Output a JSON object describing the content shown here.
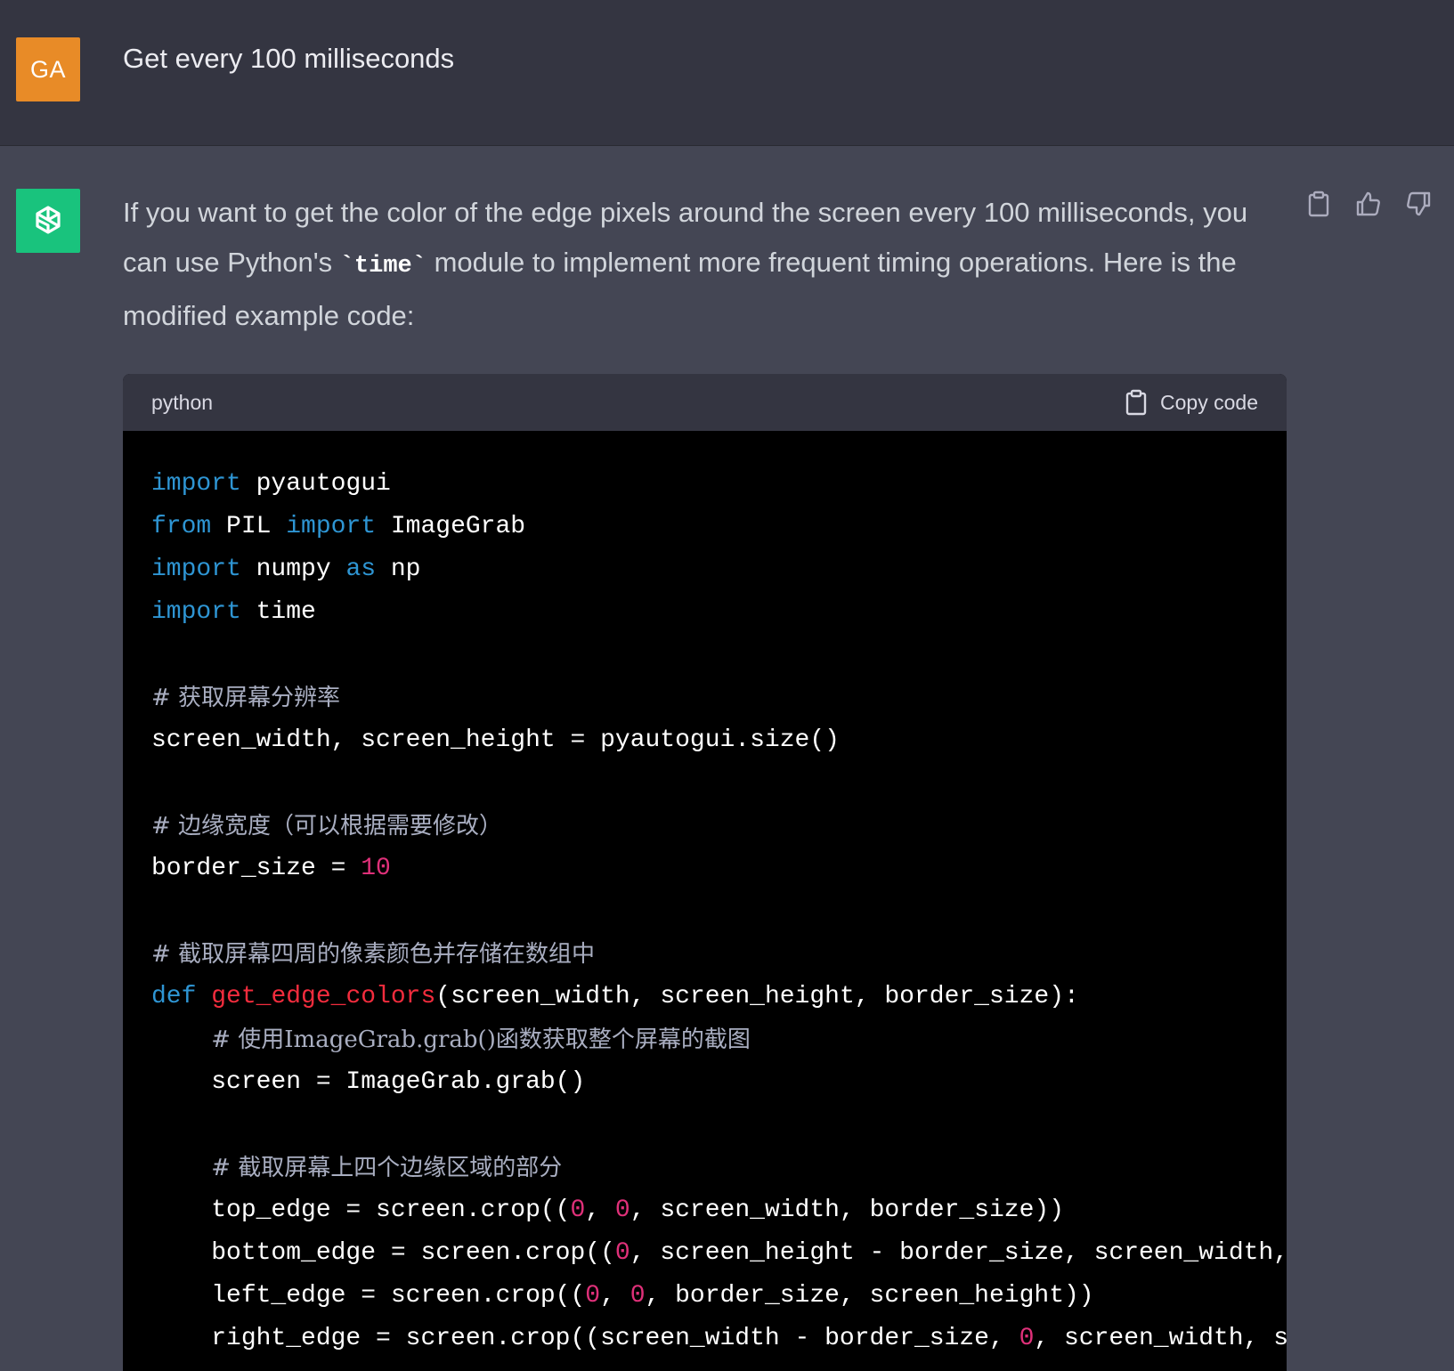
{
  "user": {
    "avatar_initials": "GA",
    "avatar_color": "#e88b27",
    "message": "Get every 100 milliseconds"
  },
  "assistant": {
    "avatar_icon": "openai-logo-icon",
    "avatar_color": "#19c37d",
    "reply_part1": "If you want to get the color of the edge pixels around the screen every 100 milliseconds, you can use Python's ",
    "reply_code": "`time`",
    "reply_part2": " module to implement more frequent timing operations. Here is the modified example code:",
    "actions": [
      "clipboard-icon",
      "thumbs-up-icon",
      "thumbs-down-icon"
    ]
  },
  "code_block": {
    "language": "python",
    "copy_label": "Copy code",
    "lines": [
      [
        [
          "kw",
          "import"
        ],
        [
          "t",
          " pyautogui"
        ]
      ],
      [
        [
          "kw",
          "from"
        ],
        [
          "t",
          " PIL "
        ],
        [
          "kw",
          "import"
        ],
        [
          "t",
          " ImageGrab"
        ]
      ],
      [
        [
          "kw",
          "import"
        ],
        [
          "t",
          " numpy "
        ],
        [
          "kw",
          "as"
        ],
        [
          "t",
          " np"
        ]
      ],
      [
        [
          "kw",
          "import"
        ],
        [
          "t",
          " time"
        ]
      ],
      [],
      [
        [
          "cm",
          "# 获取屏幕分辨率"
        ]
      ],
      [
        [
          "t",
          "screen_width, screen_height = pyautogui.size()"
        ]
      ],
      [],
      [
        [
          "cm",
          "# 边缘宽度（可以根据需要修改）"
        ]
      ],
      [
        [
          "t",
          "border_size = "
        ],
        [
          "num",
          "10"
        ]
      ],
      [],
      [
        [
          "cm",
          "# 截取屏幕四周的像素颜色并存储在数组中"
        ]
      ],
      [
        [
          "kw",
          "def"
        ],
        [
          "t",
          " "
        ],
        [
          "fn",
          "get_edge_colors"
        ],
        [
          "t",
          "(screen_width, screen_height, border_size):"
        ]
      ],
      [
        [
          "t",
          "    "
        ],
        [
          "cm",
          "# 使用ImageGrab.grab()函数获取整个屏幕的截图"
        ]
      ],
      [
        [
          "t",
          "    screen = ImageGrab.grab()"
        ]
      ],
      [],
      [
        [
          "t",
          "    "
        ],
        [
          "cm",
          "# 截取屏幕上四个边缘区域的部分"
        ]
      ],
      [
        [
          "t",
          "    top_edge = screen.crop(("
        ],
        [
          "num",
          "0"
        ],
        [
          "t",
          ", "
        ],
        [
          "num",
          "0"
        ],
        [
          "t",
          ", screen_width, border_size))"
        ]
      ],
      [
        [
          "t",
          "    bottom_edge = screen.crop(("
        ],
        [
          "num",
          "0"
        ],
        [
          "t",
          ", screen_height - border_size, screen_width, screen_height))"
        ]
      ],
      [
        [
          "t",
          "    left_edge = screen.crop(("
        ],
        [
          "num",
          "0"
        ],
        [
          "t",
          ", "
        ],
        [
          "num",
          "0"
        ],
        [
          "t",
          ", border_size, screen_height))"
        ]
      ],
      [
        [
          "t",
          "    right_edge = screen.crop((screen_width - border_size, "
        ],
        [
          "num",
          "0"
        ],
        [
          "t",
          ", screen_width, screen_height))"
        ]
      ]
    ]
  }
}
